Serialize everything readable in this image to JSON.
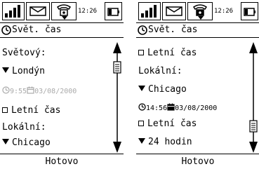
{
  "left": {
    "status": {
      "time": "12:26"
    },
    "title": "Svět. čas",
    "rows": {
      "world_label": "Světový:",
      "world_city": "Londýn",
      "world_time": "9:55",
      "world_date": "03/08/2000",
      "dst_label": "Letní čas",
      "local_label": "Lokální:",
      "local_city": "Chicago"
    },
    "done": "Hotovo"
  },
  "right": {
    "status": {
      "time": "12:26"
    },
    "title": "Svět. čas",
    "rows": {
      "dst_label": "Letní čas",
      "local_label": "Lokální:",
      "local_city": "Chicago",
      "local_time": "14:56",
      "local_date": "03/08/2000",
      "dst_label2": "Letní čas",
      "format": "24 hodin"
    },
    "done": "Hotovo"
  }
}
